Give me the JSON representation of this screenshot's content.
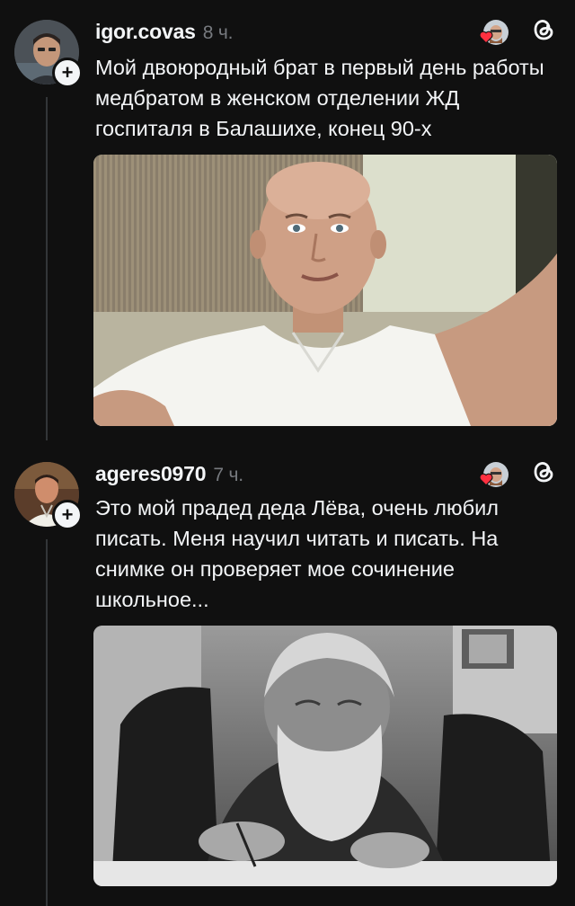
{
  "posts": [
    {
      "username": "igor.covas",
      "time": "8 ч.",
      "text": "Мой двоюродный брат в первый день работы медбратом в женском отделении ЖД госпиталя в Балашихе, конец 90-х",
      "image_icon": "photo-bald-man-selfie"
    },
    {
      "username": "ageres0970",
      "time": "7 ч.",
      "text": "Это мой прадед деда Лёва, очень любил писать. Меня научил читать и писать. На снимке он проверяет мое сочинение школьное...",
      "image_icon": "photo-old-bearded-man-writing"
    }
  ],
  "icons": {
    "follow": "plus-icon",
    "liked_by": "heart-icon",
    "app": "threads-logo-icon"
  },
  "colors": {
    "background": "#101010",
    "text": "#f3f5f7",
    "secondary": "#777a7f",
    "heart": "#ff3040",
    "thread_line": "#333638"
  }
}
